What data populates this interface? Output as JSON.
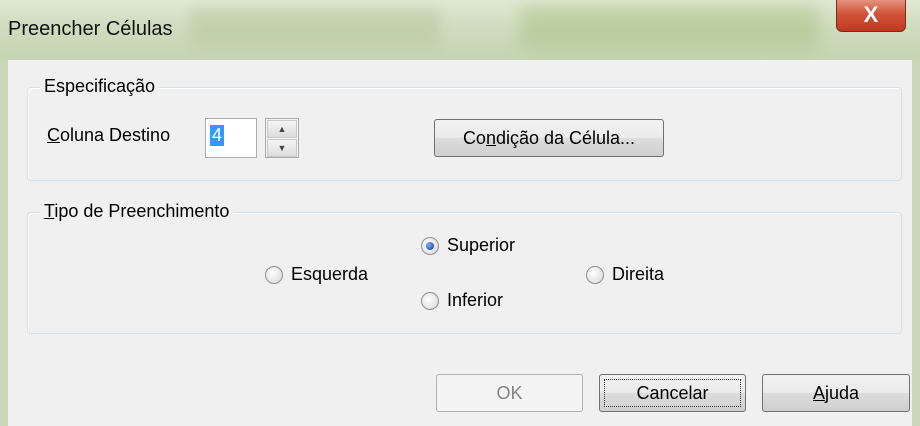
{
  "window": {
    "title": "Preencher Células",
    "close_glyph": "X"
  },
  "especificacao": {
    "legend": "Especificação",
    "coluna_label_first": "C",
    "coluna_label_rest": "oluna Destino",
    "coluna_value": "4",
    "condicao_button_first": "Co",
    "condicao_button_u": "n",
    "condicao_button_rest": "dição da Célula..."
  },
  "tipo": {
    "legend_u": "T",
    "legend_rest": "ipo de Preenchimento",
    "options": [
      {
        "label": "Esquerda",
        "checked": false
      },
      {
        "label": "Superior",
        "checked": true
      },
      {
        "label": "Inferior",
        "checked": false
      },
      {
        "label": "Direita",
        "checked": false
      }
    ]
  },
  "buttons": {
    "ok": "OK",
    "cancel": "Cancelar",
    "help_u": "A",
    "help_rest": "juda"
  },
  "colors": {
    "selection": "#3399ff",
    "radio_dot": "#2458b6",
    "close_red": "#c0381e"
  }
}
